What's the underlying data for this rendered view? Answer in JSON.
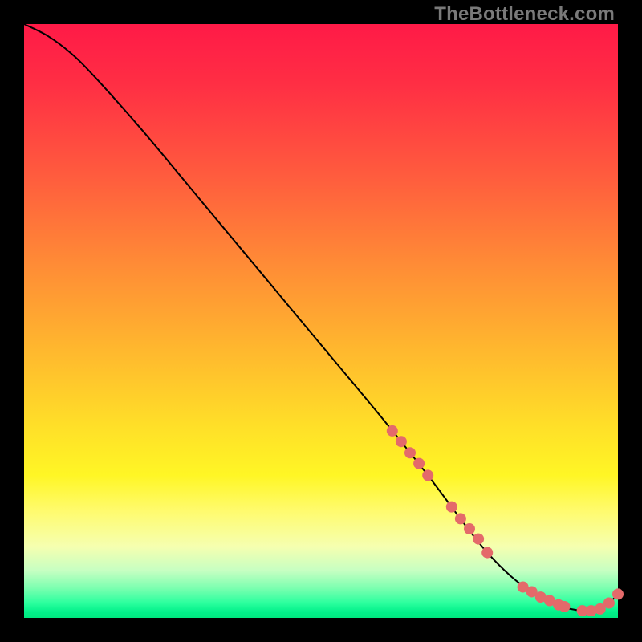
{
  "watermark": "TheBottleneck.com",
  "colors": {
    "dot": "#e46a6a",
    "line": "#000000"
  },
  "chart_data": {
    "type": "line",
    "title": "",
    "xlabel": "",
    "ylabel": "",
    "xlim": [
      0,
      100
    ],
    "ylim": [
      0,
      100
    ],
    "curve": {
      "x": [
        0,
        4,
        8,
        12,
        20,
        30,
        40,
        50,
        60,
        68,
        74,
        78,
        82,
        86,
        88,
        90,
        92,
        94,
        96,
        98,
        100
      ],
      "y": [
        100,
        98,
        95,
        91,
        82,
        70,
        58,
        46,
        34,
        24,
        16,
        11,
        7,
        4,
        3,
        2,
        1.5,
        1.2,
        1.2,
        2,
        4
      ]
    },
    "dots": {
      "x": [
        62,
        63.5,
        65,
        66.5,
        68,
        72,
        73.5,
        75,
        76.5,
        78,
        84,
        85.5,
        87,
        88.5,
        90,
        91,
        94,
        95.5,
        97,
        98.5,
        100
      ],
      "y": [
        31.5,
        29.7,
        27.8,
        26,
        24,
        18.7,
        16.7,
        15,
        13.3,
        11,
        5.2,
        4.4,
        3.5,
        2.9,
        2.2,
        1.9,
        1.2,
        1.2,
        1.5,
        2.5,
        4
      ]
    }
  }
}
